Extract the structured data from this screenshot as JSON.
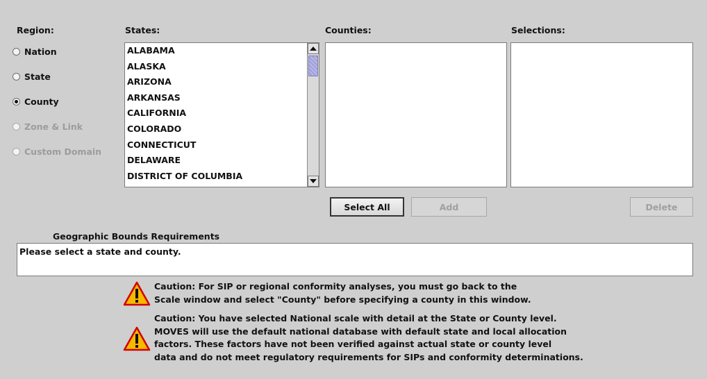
{
  "region": {
    "label": "Region:",
    "options": [
      {
        "label": "Nation",
        "selected": false,
        "enabled": true
      },
      {
        "label": "State",
        "selected": false,
        "enabled": true
      },
      {
        "label": "County",
        "selected": true,
        "enabled": true
      },
      {
        "label": "Zone & Link",
        "selected": false,
        "enabled": false
      },
      {
        "label": "Custom Domain",
        "selected": false,
        "enabled": false
      }
    ]
  },
  "states": {
    "label": "States:",
    "items": [
      "ALABAMA",
      "ALASKA",
      "ARIZONA",
      "ARKANSAS",
      "CALIFORNIA",
      "COLORADO",
      "CONNECTICUT",
      "DELAWARE",
      "DISTRICT OF COLUMBIA"
    ]
  },
  "counties": {
    "label": "Counties:",
    "items": []
  },
  "selections": {
    "label": "Selections:",
    "items": []
  },
  "buttons": {
    "select_all": "Select All",
    "add": "Add",
    "delete": "Delete"
  },
  "bounds": {
    "title": "Geographic Bounds Requirements",
    "message": "Please select a state and county."
  },
  "cautions": [
    {
      "icon": "warning-icon",
      "lines": [
        "Caution: For SIP or regional conformity analyses, you must go back to the",
        "Scale window and select \"County\" before specifying a county in this window."
      ]
    },
    {
      "icon": "warning-icon",
      "lines": [
        "Caution: You have selected National scale with detail at the State or County level.",
        "MOVES will use the default national database with default state and local allocation",
        "factors. These factors have not been verified against actual state or county level",
        "data and do not meet regulatory requirements for SIPs and conformity determinations."
      ]
    }
  ],
  "colors": {
    "background": "#cfcfcf",
    "warning_fill": "#f7b800",
    "warning_border": "#d00000"
  }
}
